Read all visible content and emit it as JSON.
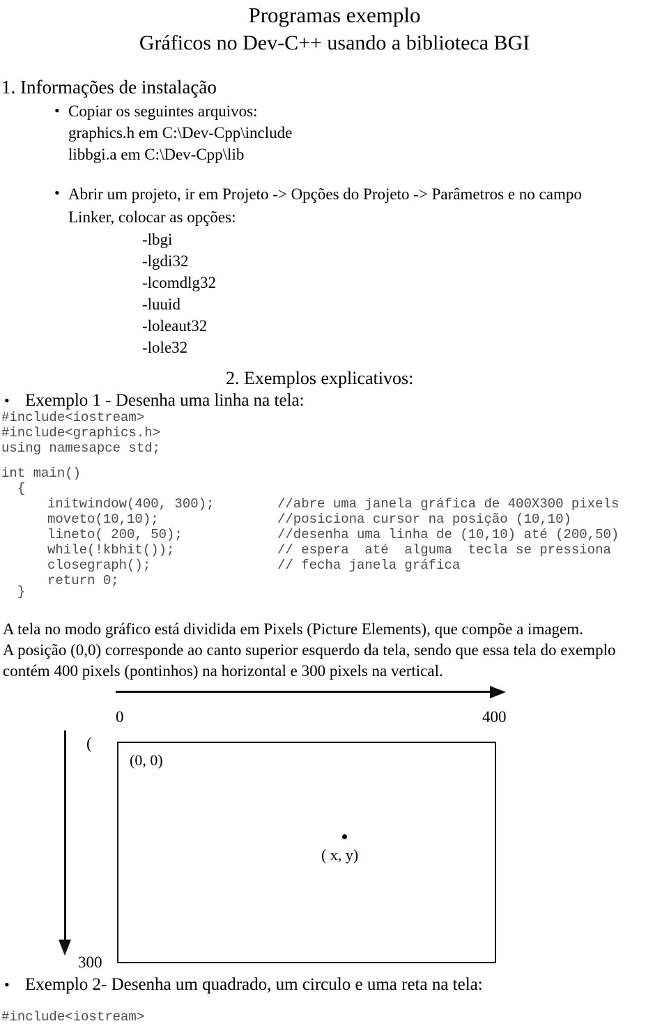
{
  "title": {
    "line1": "Programas exemplo",
    "line2": "Gráficos no Dev-C++  usando a biblioteca BGI"
  },
  "section1": {
    "heading": "1. Informações de instalação",
    "bullet_copiar": {
      "marker": "•",
      "line1": "Copiar os  seguintes arquivos:",
      "line2": "graphics.h  em  C:\\Dev-Cpp\\include",
      "line3": "libbgi.a   em C:\\Dev-Cpp\\lib"
    },
    "bullet_abrir": {
      "marker": "•",
      "line1": "Abrir um projeto, ir em  Projeto -> Opções do Projeto -> Parâmetros e  no campo",
      "line2": "Linker, colocar as opções:",
      "linker_options": [
        "-lbgi",
        "-lgdi32",
        "-lcomdlg32",
        "-luuid",
        "-loleaut32",
        "-lole32"
      ]
    }
  },
  "section2": {
    "heading": "2. Exemplos explicativos:",
    "example1": {
      "marker": "•",
      "label": "Exemplo 1 -  Desenha uma linha  na tela:",
      "code_header": "#include<iostream>\n#include<graphics.h>\nusing namesapce std;",
      "code_main_open": "int main()\n  {",
      "code_lines": [
        {
          "stmt": "initwindow(400, 300);",
          "comment": "//abre uma janela gráfica de 400X300 pixels"
        },
        {
          "stmt": "moveto(10,10);",
          "comment": "//posiciona cursor na posição (10,10)"
        },
        {
          "stmt": "lineto( 200, 50);",
          "comment": "//desenha uma linha de (10,10) até (200,50)"
        },
        {
          "stmt": "while(!kbhit());",
          "comment": "// espera  até  alguma  tecla se pressiona"
        },
        {
          "stmt": "closegraph();",
          "comment": "// fecha janela gráfica"
        },
        {
          "stmt": "return 0;",
          "comment": ""
        }
      ],
      "code_close": "  }"
    },
    "example2": {
      "marker": "•",
      "label": "Exemplo  2-  Desenha um  quadrado, um circulo e uma reta  na  tela:",
      "code_header": "#include<iostream>"
    }
  },
  "paragraph": {
    "line1": "A tela no modo gráfico está dividida em Pixels (Picture Elements), que compõe a imagem.",
    "line2": "A posição (0,0) corresponde ao canto superior esquerdo da tela, sendo que essa tela do exemplo",
    "line3": "contém 400 pixels (pontinhos) na horizontal e 300 pixels na vertical."
  },
  "diagram": {
    "x_axis_start_label": "0",
    "x_axis_end_label": "400",
    "y_axis_start_label": "(",
    "y_axis_end_label": "300",
    "origin_label": "(0, 0)",
    "point_label": "( x, y)"
  }
}
